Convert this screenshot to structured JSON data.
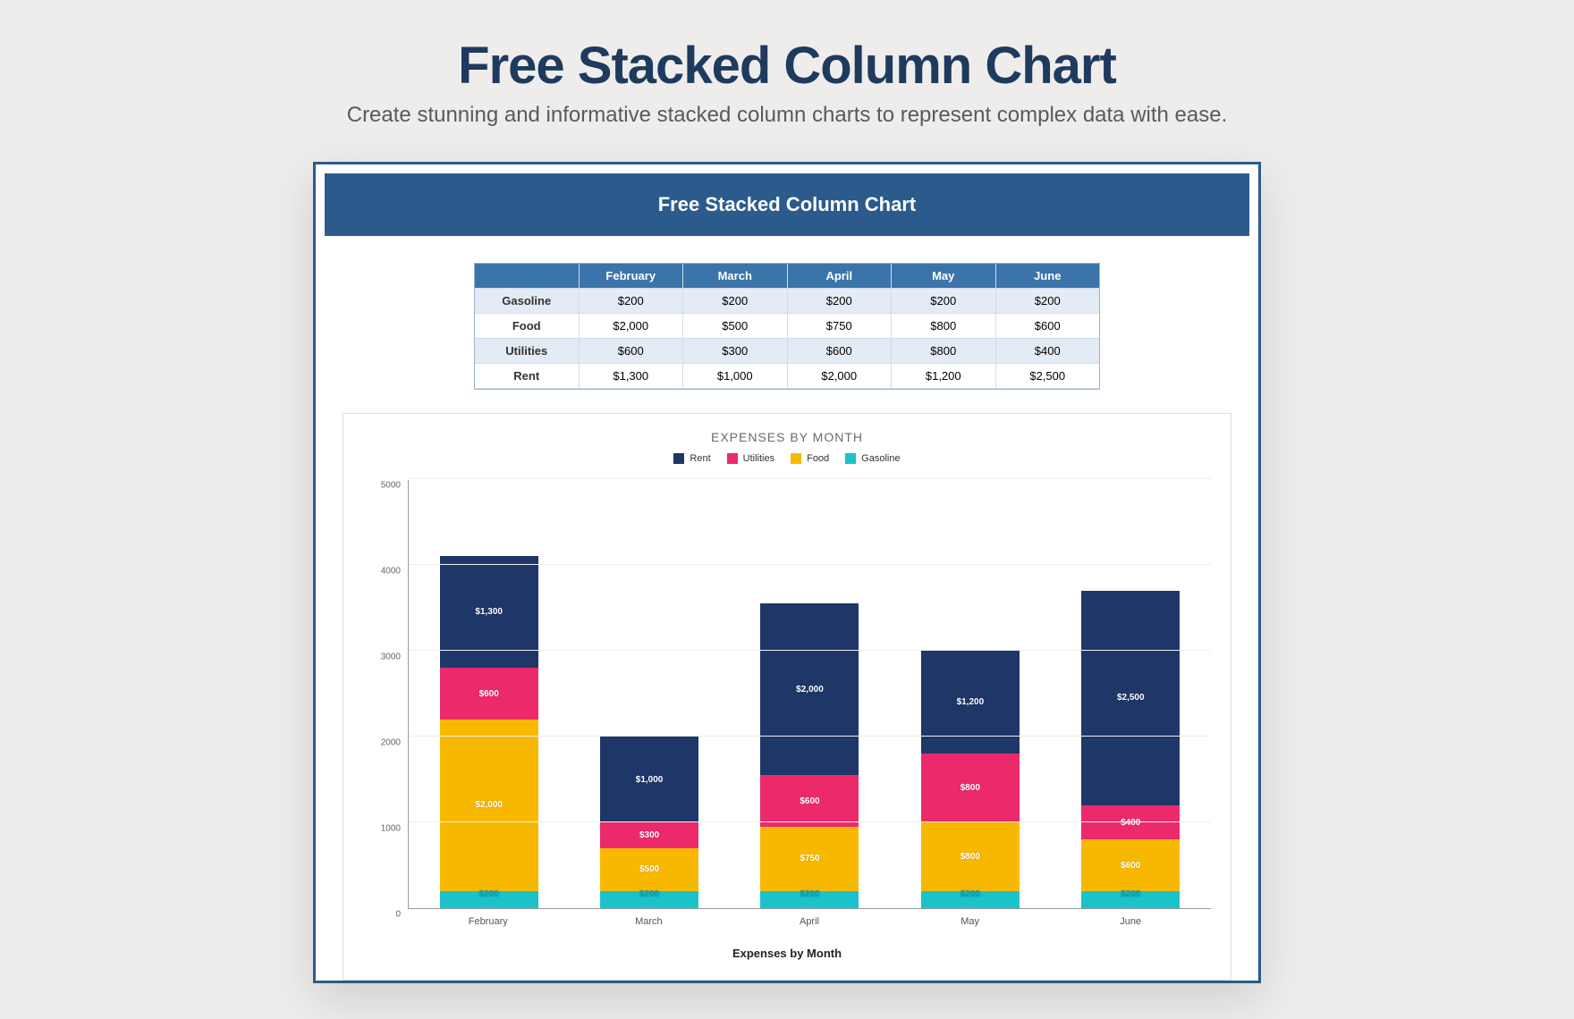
{
  "page": {
    "headline": "Free Stacked Column Chart",
    "subheadline": "Create stunning and informative stacked column charts to represent complex data with ease."
  },
  "doc": {
    "banner_title": "Free Stacked Column Chart"
  },
  "table": {
    "header_blank": "",
    "columns": [
      "February",
      "March",
      "April",
      "May",
      "June"
    ],
    "rows": [
      {
        "label": "Gasoline",
        "cells": [
          "$200",
          "$200",
          "$200",
          "$200",
          "$200"
        ]
      },
      {
        "label": "Food",
        "cells": [
          "$2,000",
          "$500",
          "$750",
          "$800",
          "$600"
        ]
      },
      {
        "label": "Utilities",
        "cells": [
          "$600",
          "$300",
          "$600",
          "$800",
          "$400"
        ]
      },
      {
        "label": "Rent",
        "cells": [
          "$1,300",
          "$1,000",
          "$2,000",
          "$1,200",
          "$2,500"
        ]
      }
    ]
  },
  "chart_data": {
    "type": "bar",
    "stacked": true,
    "title": "EXPENSES BY MONTH",
    "xlabel": "Expenses by Month",
    "ylabel": "",
    "ylim": [
      0,
      5000
    ],
    "yticks": [
      0,
      1000,
      2000,
      3000,
      4000,
      5000
    ],
    "categories": [
      "February",
      "March",
      "April",
      "May",
      "June"
    ],
    "series": [
      {
        "name": "Rent",
        "color": "#1e3768",
        "values": [
          1300,
          1000,
          2000,
          1200,
          2500
        ],
        "labels": [
          "$1,300",
          "$1,000",
          "$2,000",
          "$1,200",
          "$2,500"
        ]
      },
      {
        "name": "Utilities",
        "color": "#ec2a6b",
        "values": [
          600,
          300,
          600,
          800,
          400
        ],
        "labels": [
          "$600",
          "$300",
          "$600",
          "$800",
          "$400"
        ]
      },
      {
        "name": "Food",
        "color": "#f8b800",
        "values": [
          2000,
          500,
          750,
          800,
          600
        ],
        "labels": [
          "$2,000",
          "$500",
          "$750",
          "$800",
          "$600"
        ]
      },
      {
        "name": "Gasoline",
        "color": "#1cc2c9",
        "values": [
          200,
          200,
          200,
          200,
          200
        ],
        "labels": [
          "$200",
          "$200",
          "$200",
          "$200",
          "$200"
        ]
      }
    ],
    "legend_order": [
      "Rent",
      "Utilities",
      "Food",
      "Gasoline"
    ],
    "stack_order_bottom_to_top": [
      "Gasoline",
      "Food",
      "Utilities",
      "Rent"
    ]
  }
}
